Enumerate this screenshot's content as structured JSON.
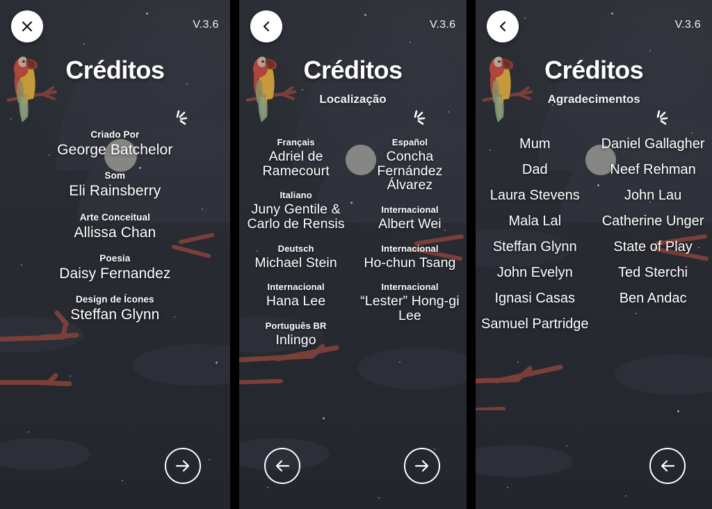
{
  "app": {
    "version_label": "V.3.6",
    "title": "Créditos"
  },
  "panels": [
    {
      "id": "panel-credits-main",
      "nav_icon": "close-icon",
      "subtitle": "",
      "credits": [
        {
          "role": "Criado Por",
          "name": "George Batchelor"
        },
        {
          "role": "Som",
          "name": "Eli Rainsberry"
        },
        {
          "role": "Arte Conceitual",
          "name": "Allissa Chan"
        },
        {
          "role": "Poesia",
          "name": "Daisy Fernandez"
        },
        {
          "role": "Design de Ícones",
          "name": "Steffan Glynn"
        }
      ],
      "bottom": {
        "next": "next-arrow-icon"
      }
    },
    {
      "id": "panel-credits-localization",
      "nav_icon": "back-chevron-icon",
      "subtitle": "Localização",
      "left_column": [
        {
          "role": "Français",
          "name": "Adriel de Ramecourt"
        },
        {
          "role": "Italiano",
          "name": "Juny Gentile & Carlo de Rensis"
        },
        {
          "role": "Deutsch",
          "name": "Michael Stein"
        },
        {
          "role": "Internacional",
          "name": "Hana Lee"
        },
        {
          "role": "Português  BR",
          "name": "Inlingo"
        }
      ],
      "right_column": [
        {
          "role": "Español",
          "name": "Concha Fernández Álvarez"
        },
        {
          "role": "Internacional",
          "name": "Albert Wei"
        },
        {
          "role": "Internacional",
          "name": "Ho-chun Tsang"
        },
        {
          "role": "Internacional",
          "name": "“Lester” Hong-gi Lee"
        }
      ],
      "bottom": {
        "prev": "prev-arrow-icon",
        "next": "next-arrow-icon"
      }
    },
    {
      "id": "panel-credits-thanks",
      "nav_icon": "back-chevron-icon",
      "subtitle": "Agradecimentos",
      "left_column": [
        "Mum",
        "Dad",
        "Laura Stevens",
        "Mala Lal",
        "Steffan Glynn",
        "John Evelyn",
        "Ignasi Casas",
        "Samuel Partridge"
      ],
      "right_column": [
        "Daniel Gallagher",
        "Neef Rehman",
        "John Lau",
        "Catherine Unger",
        "State of Play",
        "Ted Sterchi",
        "Ben Andac"
      ],
      "bottom": {
        "prev": "prev-arrow-icon"
      }
    }
  ],
  "colors": {
    "background": "#2b2d34",
    "text": "#ffffff",
    "nav_button": "#ffffff",
    "moon": "#8d8d8b",
    "branch": "#7a4038",
    "parrot_red": "#b0453c",
    "parrot_yellow": "#c59a3b",
    "parrot_green": "#7e9073",
    "divider": "#000000"
  }
}
